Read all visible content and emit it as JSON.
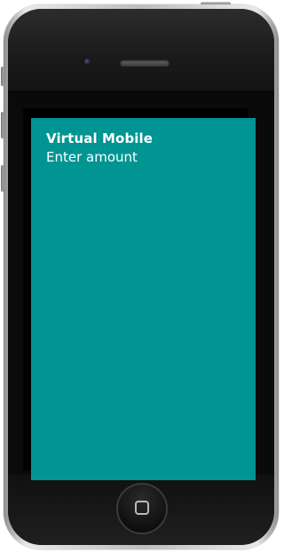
{
  "screen": {
    "title": "Virtual Mobile",
    "prompt": "Enter amount",
    "background_color": "#009593",
    "text_color": "#ffffff"
  },
  "device": {
    "body_color": "#0a0a0a",
    "home_icon": "home-square-icon",
    "camera_icon": "front-camera-icon",
    "speaker_icon": "earpiece-speaker-icon"
  }
}
